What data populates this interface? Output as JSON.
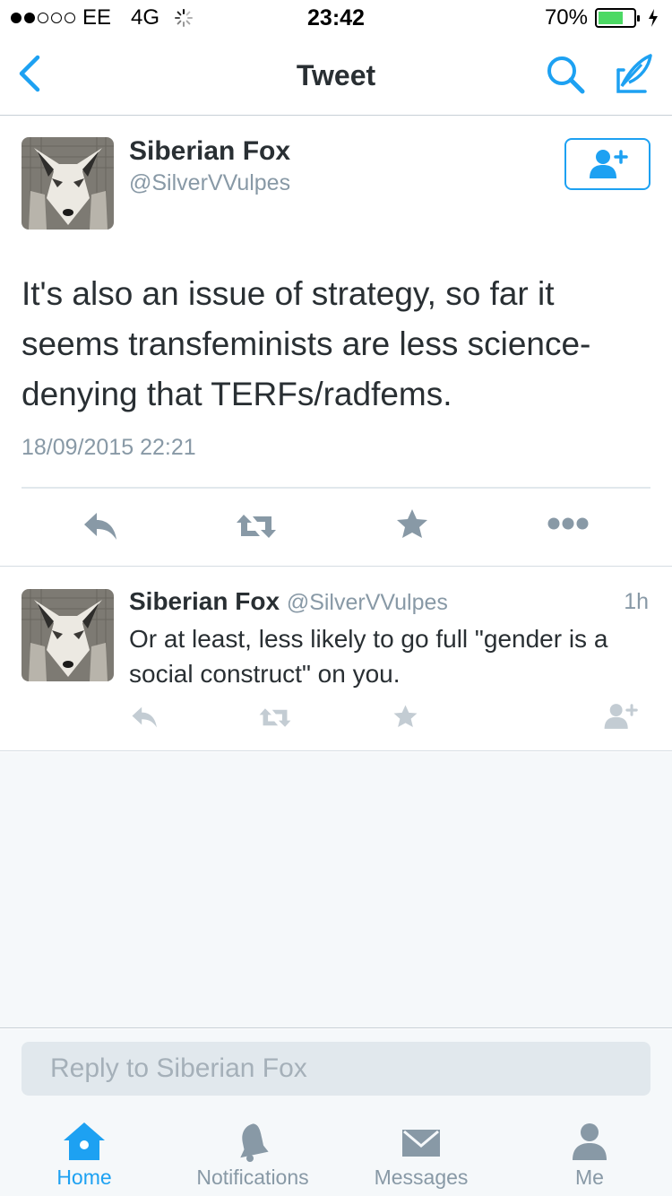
{
  "status_bar": {
    "carrier": "EE",
    "network": "4G",
    "time": "23:42",
    "battery": "70%",
    "battery_level": 0.7
  },
  "nav": {
    "title": "Tweet"
  },
  "main_tweet": {
    "name": "Siberian Fox",
    "handle": "@SilverVVulpes",
    "text": "It's also an issue of strategy, so far it seems transfeminists are less science-denying that TERFs/radfems.",
    "timestamp": "18/09/2015 22:21"
  },
  "reply_tweet": {
    "name": "Siberian Fox",
    "handle": "@SilverVVulpes",
    "age": "1h",
    "text": "Or at least, less likely to go full \"gender is a social construct\" on you."
  },
  "reply_box": {
    "placeholder": "Reply to Siberian Fox"
  },
  "tabs": [
    {
      "label": "Home",
      "icon": "home-icon",
      "active": true
    },
    {
      "label": "Notifications",
      "icon": "bell-icon",
      "active": false
    },
    {
      "label": "Messages",
      "icon": "envelope-icon",
      "active": false
    },
    {
      "label": "Me",
      "icon": "person-icon",
      "active": false
    }
  ],
  "colors": {
    "accent": "#1da1f2",
    "muted": "#8899a6",
    "text": "#292f33",
    "battery": "#4cd964"
  }
}
